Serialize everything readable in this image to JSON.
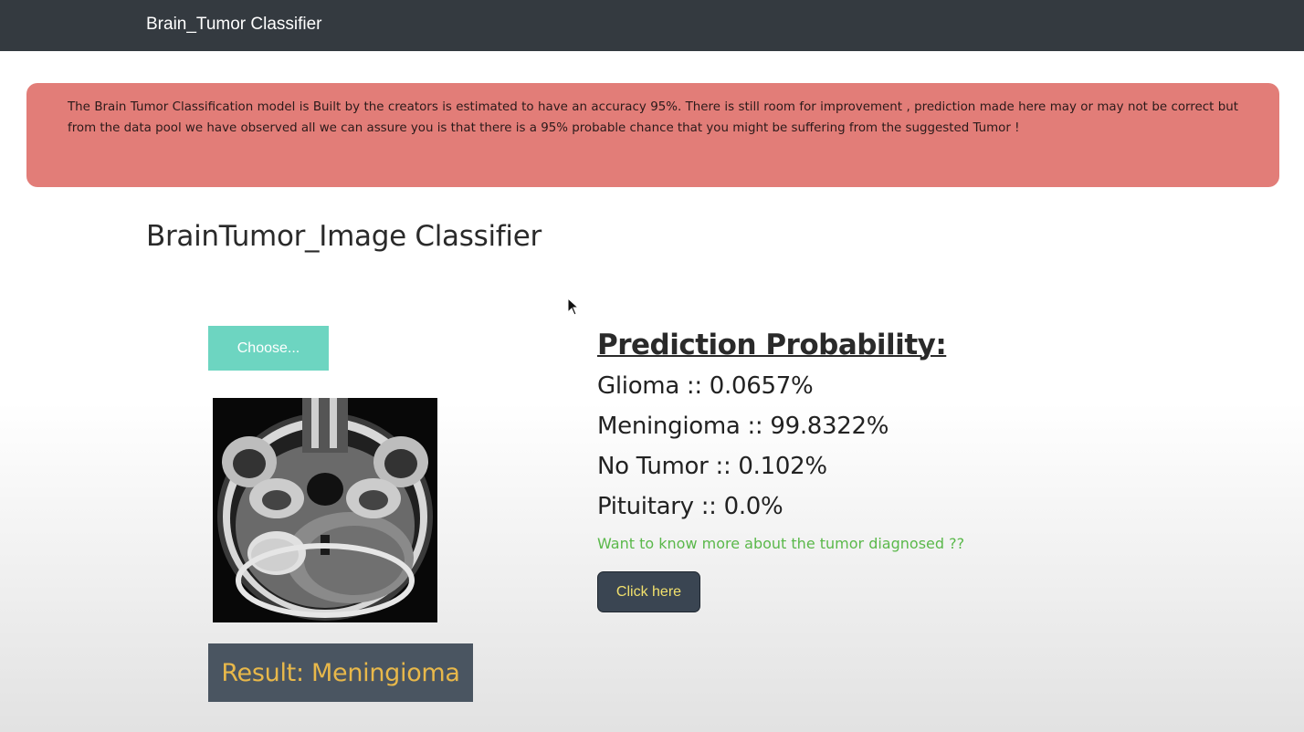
{
  "navbar": {
    "brand": "Brain_Tumor Classifier"
  },
  "alert": {
    "text": "The Brain Tumor Classification model is Built by the creators is estimated to have an accuracy 95%. There is still room for improvement , prediction made here may or may not be correct but from the data pool we have observed all we can assure you is that there is a 95% probable chance that you might be suffering from the suggested Tumor !",
    "color": "#e27d78"
  },
  "main": {
    "title": "BrainTumor_Image Classifier",
    "choose_label": "Choose...",
    "result_label": "Result: Meningioma",
    "prediction_title": "Prediction Probability:",
    "probabilities": [
      {
        "text": "Glioma :: 0.0657%"
      },
      {
        "text": "Meningioma :: 99.8322%"
      },
      {
        "text": "No Tumor :: 0.102%"
      },
      {
        "text": "Pituitary :: 0.0%"
      }
    ],
    "more_info_text": "Want to know more about the tumor diagnosed ??",
    "click_label": "Click here"
  },
  "colors": {
    "navbar": "#343a40",
    "choose_button": "#6dd5c1",
    "result_box": "#4a5561",
    "result_text": "#e8b84a",
    "more_info_text": "#5ab84a",
    "click_button_text": "#f1e06c"
  },
  "icons": [
    "brain-mri-image",
    "mouse-pointer-icon"
  ]
}
